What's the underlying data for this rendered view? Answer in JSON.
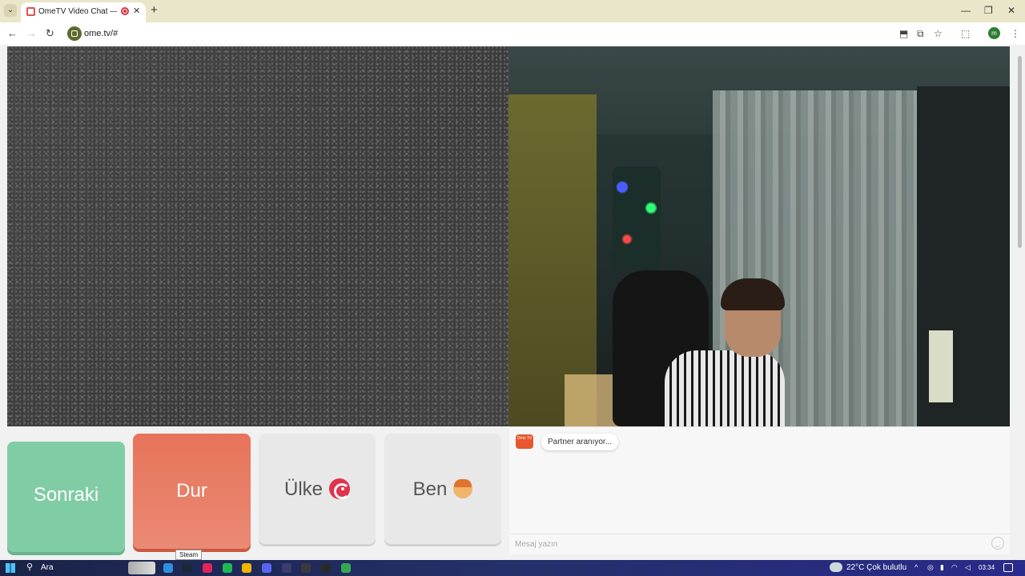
{
  "browser": {
    "tab_title": "OmeTV Video Chat — Ome",
    "tab_close": "✕",
    "new_tab": "+",
    "url": "ome.tv/#",
    "profile_initial": "m",
    "window": {
      "minimize": "—",
      "restore": "❐",
      "close": "✕"
    }
  },
  "controls": {
    "next_label": "Sonraki",
    "stop_label": "Dur",
    "country_label": "Ülke",
    "me_label": "Ben"
  },
  "chat": {
    "logo_text": "Ome TV",
    "status_message": "Partner aranıyor...",
    "input_placeholder": "Mesaj yazın"
  },
  "tooltip": "Steam",
  "taskbar": {
    "search_label": "Ara",
    "weather": "22°C  Çok bulutlu",
    "time": "03:34",
    "apps": [
      {
        "name": "vscode",
        "color": "#2f8fe0"
      },
      {
        "name": "steam",
        "color": "#1b2838"
      },
      {
        "name": "media",
        "color": "#e0245e"
      },
      {
        "name": "spotify",
        "color": "#1db954"
      },
      {
        "name": "chrome",
        "color": "#f4b400"
      },
      {
        "name": "discord",
        "color": "#5865f2"
      },
      {
        "name": "app",
        "color": "#3c3c70"
      },
      {
        "name": "xbox",
        "color": "#3a3a3a"
      },
      {
        "name": "app2",
        "color": "#2a2a2a"
      },
      {
        "name": "chrome-active",
        "color": "#34a853"
      }
    ]
  }
}
